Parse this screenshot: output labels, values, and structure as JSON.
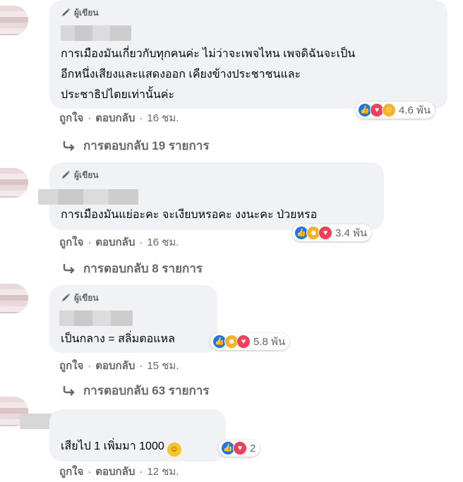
{
  "comments": [
    {
      "author_badge": "ผู้เขียน",
      "text": "การเมืองมันเกี่ยวกับทุกคนค่ะ ไม่ว่าจะเพจไหน เพจดิฉันจะเป็น\nอีกหนึ่งเสียงและแสดงออก เคียงข้างประชาชนและ\nประชาธิปไตยเท่านั้นค่ะ",
      "reactions": [
        "like",
        "love",
        "care"
      ],
      "reaction_count": "4.6 พัน",
      "like_label": "ถูกใจ",
      "reply_label": "ตอบกลับ",
      "time": "16 ชม.",
      "replies_text": "การตอบกลับ 19 รายการ"
    },
    {
      "author_badge": "ผู้เขียน",
      "text": "การเมืองมันแย่อะคะ จะเงียบหรอคะ งงนะคะ ป่วยหรอ",
      "reactions": [
        "like",
        "haha",
        "love"
      ],
      "reaction_count": "3.4 พัน",
      "like_label": "ถูกใจ",
      "reply_label": "ตอบกลับ",
      "time": "16 ชม.",
      "replies_text": "การตอบกลับ 8 รายการ"
    },
    {
      "author_badge": "ผู้เขียน",
      "text": "เป็นกลาง = สลิ่มตอแหล",
      "reactions": [
        "like",
        "haha",
        "love"
      ],
      "reaction_count": "5.8 พัน",
      "like_label": "ถูกใจ",
      "reply_label": "ตอบกลับ",
      "time": "15 ชม.",
      "replies_text": "การตอบกลับ 63 รายการ"
    },
    {
      "text": "เสียไป 1 เพิ่มมา 1000",
      "reactions": [
        "like",
        "love"
      ],
      "reaction_count": "2",
      "like_label": "ถูกใจ",
      "reply_label": "ตอบกลับ",
      "time": "12 ชม."
    }
  ],
  "colors": {
    "bubble": "#f0f2f5",
    "meta_text": "#65676b",
    "like": "#1877f2",
    "love": "#f33e58",
    "care_haha": "#f7b125"
  },
  "icons": {
    "author": "pen-icon",
    "replies": "reply-arrow-icon",
    "emoji": "grinning-face-icon"
  }
}
